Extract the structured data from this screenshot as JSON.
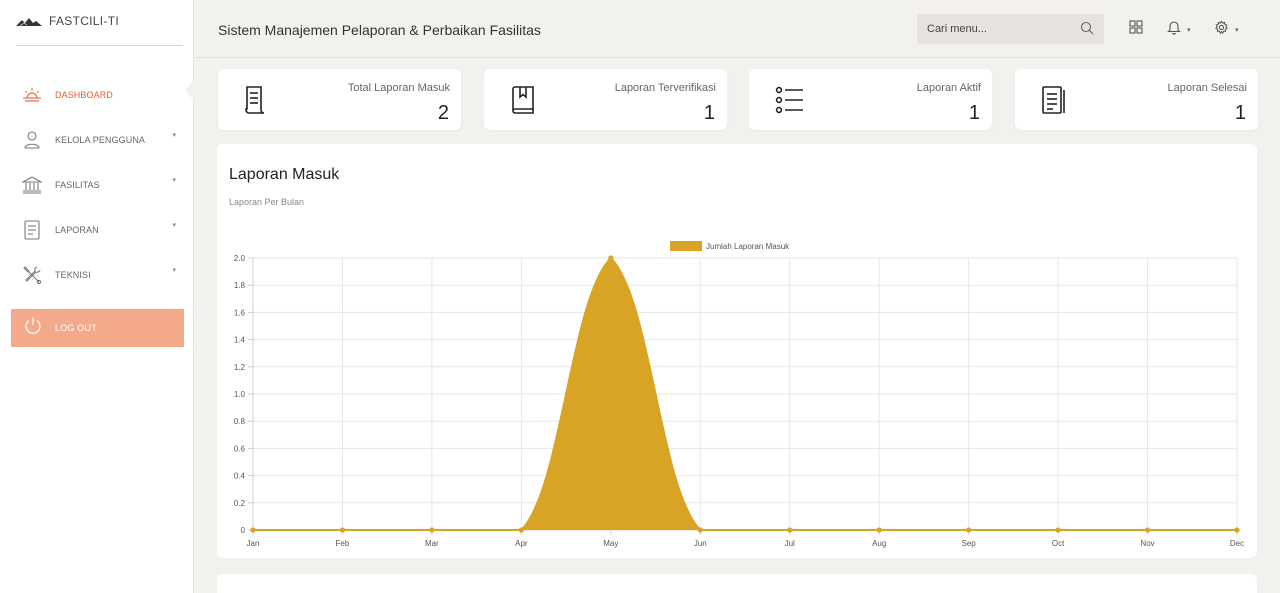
{
  "brand": {
    "name": "FASTCILI-TI"
  },
  "sidebar": {
    "items": [
      {
        "label": "DASHBOARD",
        "icon": "sunrise-icon",
        "active": true
      },
      {
        "label": "KELOLA PENGGUNA",
        "icon": "user-icon",
        "caret": "▾"
      },
      {
        "label": "FASILITAS",
        "icon": "building-icon",
        "caret": "▾"
      },
      {
        "label": "LAPORAN",
        "icon": "document-icon",
        "caret": "▾"
      },
      {
        "label": "TEKNISI",
        "icon": "tools-icon",
        "caret": "▾"
      }
    ],
    "logout": {
      "label": "LOG OUT",
      "icon": "power-icon"
    }
  },
  "header": {
    "title": "Sistem Manajemen Pelaporan & Perbaikan Fasilitas",
    "search_placeholder": "Cari menu...",
    "dropdown_caret": "▾"
  },
  "cards": [
    {
      "label": "Total Laporan Masuk",
      "value": "2",
      "icon": "receipt-icon"
    },
    {
      "label": "Laporan Terverifikasi",
      "value": "1",
      "icon": "book-icon"
    },
    {
      "label": "Laporan Aktif",
      "value": "1",
      "icon": "list-icon"
    },
    {
      "label": "Laporan Selesai",
      "value": "1",
      "icon": "document-list-icon"
    }
  ],
  "panel": {
    "title": "Laporan Masuk",
    "subtitle": "Laporan Per Bulan"
  },
  "colors": {
    "accent": "#e05d3b",
    "series": "#d9a425",
    "logout_bg": "#f5a98b"
  },
  "chart_data": {
    "type": "area",
    "categories": [
      "Jan",
      "Feb",
      "Mar",
      "Apr",
      "May",
      "Jun",
      "Jul",
      "Aug",
      "Sep",
      "Oct",
      "Nov",
      "Dec"
    ],
    "series": [
      {
        "name": "Jumlah Laporan Masuk",
        "values": [
          0,
          0,
          0,
          0,
          2,
          0,
          0,
          0,
          0,
          0,
          0,
          0
        ]
      }
    ],
    "yticks": [
      "0",
      "0.2",
      "0.4",
      "0.6",
      "0.8",
      "1.0",
      "1.2",
      "1.4",
      "1.6",
      "1.8",
      "2.0"
    ],
    "ylim": [
      0,
      2
    ],
    "grid": true,
    "legend": "top-center"
  }
}
